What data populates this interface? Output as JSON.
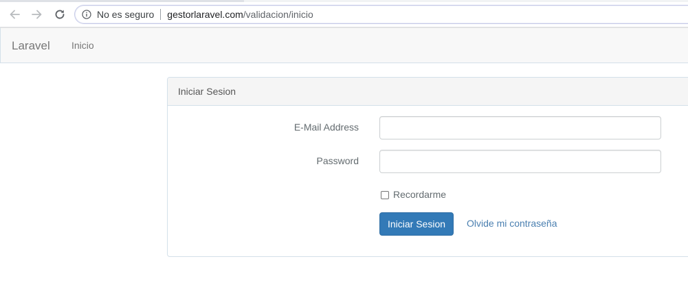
{
  "browser": {
    "security_label": "No es seguro",
    "url_host": "gestorlaravel.com",
    "url_path": "/validacion/inicio",
    "icons": {
      "back": "back-arrow-icon",
      "forward": "forward-arrow-icon",
      "reload": "reload-icon",
      "info": "info-icon"
    }
  },
  "navbar": {
    "brand": "Laravel",
    "links": [
      "Inicio"
    ]
  },
  "login_panel": {
    "title": "Iniciar Sesion",
    "email_label": "E-Mail Address",
    "email_value": "",
    "password_label": "Password",
    "password_value": "",
    "remember_label": "Recordarme",
    "remember_checked": false,
    "submit_label": "Iniciar Sesion",
    "forgot_label": "Olvide mi contraseña"
  },
  "colors": {
    "primary_button": "#337ab7",
    "link": "#4a7fb0",
    "navbar_bg": "#f8f8f8",
    "panel_border": "#d3e0e9"
  }
}
